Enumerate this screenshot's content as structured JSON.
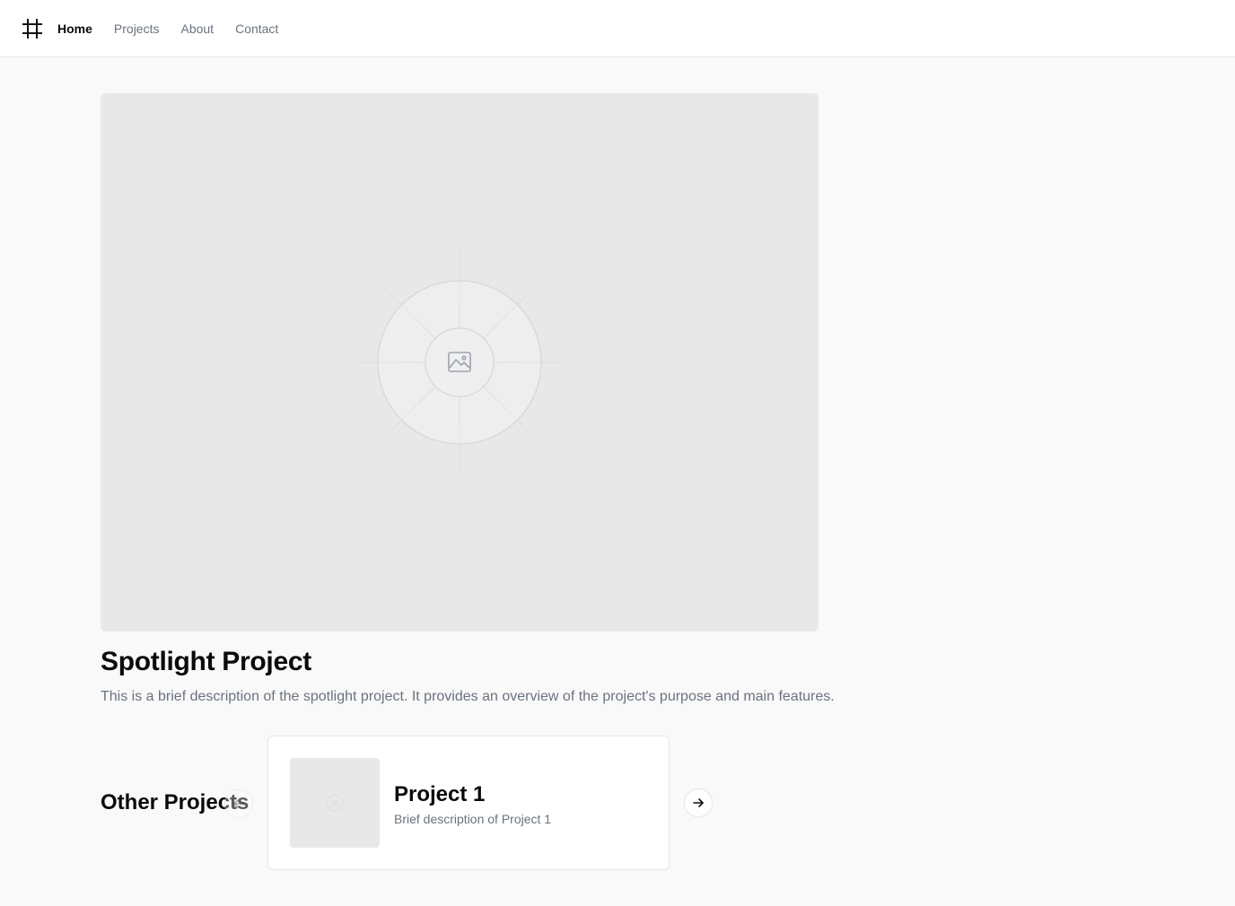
{
  "nav": {
    "logo_icon": "hash-frame-icon",
    "links": [
      {
        "label": "Home",
        "active": true
      },
      {
        "label": "Projects",
        "active": false
      },
      {
        "label": "About",
        "active": false
      },
      {
        "label": "Contact",
        "active": false
      }
    ]
  },
  "spotlight": {
    "image_icon": "image-placeholder-icon",
    "title": "Spotlight Project",
    "description": "This is a brief description of the spotlight project. It provides an overview of the project's purpose and main features."
  },
  "other_projects": {
    "title": "Other Projects",
    "prev_icon": "arrow-left-icon",
    "next_icon": "arrow-right-icon",
    "cards": [
      {
        "title": "Project 1",
        "description": "Brief description of Project 1",
        "thumb_icon": "image-placeholder-icon"
      }
    ]
  },
  "colors": {
    "background": "#f8f9f8",
    "surface": "#ffffff",
    "placeholder": "#e8e8e8",
    "text_primary": "#0a0a0a",
    "text_muted": "#6b7280",
    "border": "#e5e7eb"
  }
}
